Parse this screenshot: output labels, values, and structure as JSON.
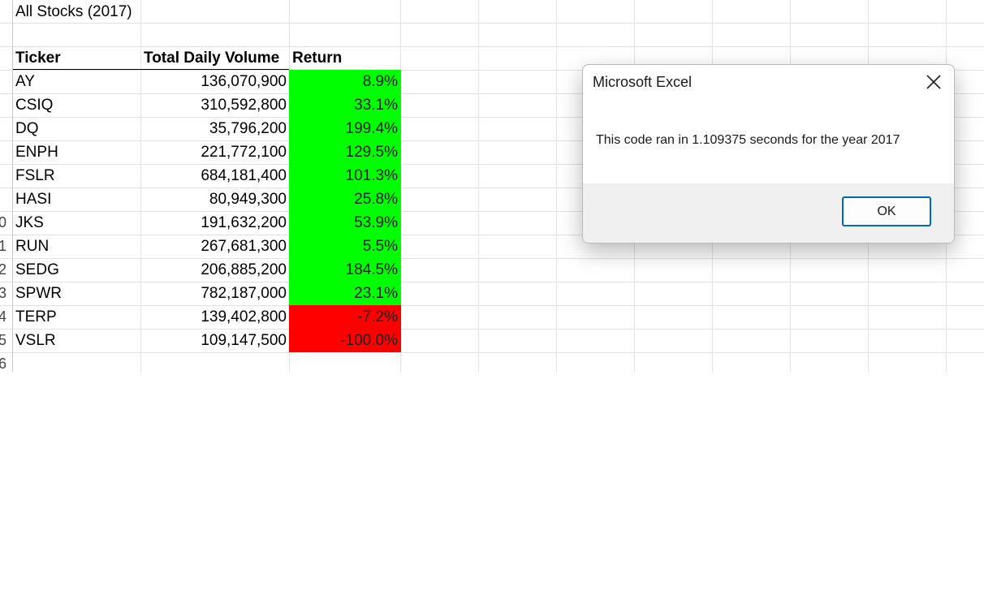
{
  "sheet": {
    "title": "All Stocks (2017)",
    "headers": {
      "ticker": "Ticker",
      "volume": "Total Daily Volume",
      "return": "Return"
    },
    "row_numbers": [
      "",
      "",
      "",
      "",
      "",
      "",
      "",
      "",
      "",
      "0",
      "1",
      "2",
      "3",
      "4",
      "5",
      "6"
    ],
    "rows": [
      {
        "ticker": "AY",
        "volume": "136,070,900",
        "return": "8.9%",
        "status": "positive"
      },
      {
        "ticker": "CSIQ",
        "volume": "310,592,800",
        "return": "33.1%",
        "status": "positive"
      },
      {
        "ticker": "DQ",
        "volume": "35,796,200",
        "return": "199.4%",
        "status": "positive"
      },
      {
        "ticker": "ENPH",
        "volume": "221,772,100",
        "return": "129.5%",
        "status": "positive"
      },
      {
        "ticker": "FSLR",
        "volume": "684,181,400",
        "return": "101.3%",
        "status": "positive"
      },
      {
        "ticker": "HASI",
        "volume": "80,949,300",
        "return": "25.8%",
        "status": "positive"
      },
      {
        "ticker": "JKS",
        "volume": "191,632,200",
        "return": "53.9%",
        "status": "positive"
      },
      {
        "ticker": "RUN",
        "volume": "267,681,300",
        "return": "5.5%",
        "status": "positive"
      },
      {
        "ticker": "SEDG",
        "volume": "206,885,200",
        "return": "184.5%",
        "status": "positive"
      },
      {
        "ticker": "SPWR",
        "volume": "782,187,000",
        "return": "23.1%",
        "status": "positive"
      },
      {
        "ticker": "TERP",
        "volume": "139,402,800",
        "return": "-7.2%",
        "status": "negative"
      },
      {
        "ticker": "VSLR",
        "volume": "109,147,500",
        "return": "-100.0%",
        "status": "negative"
      }
    ]
  },
  "colors": {
    "positive": "#00ff00",
    "negative": "#ff0000",
    "gridline": "#e1e1e1",
    "ok_border": "#0067c0"
  },
  "dialog": {
    "title": "Microsoft Excel",
    "message": "This code ran in 1.109375 seconds for the year 2017",
    "ok_label": "OK",
    "close_icon": "close-icon"
  }
}
